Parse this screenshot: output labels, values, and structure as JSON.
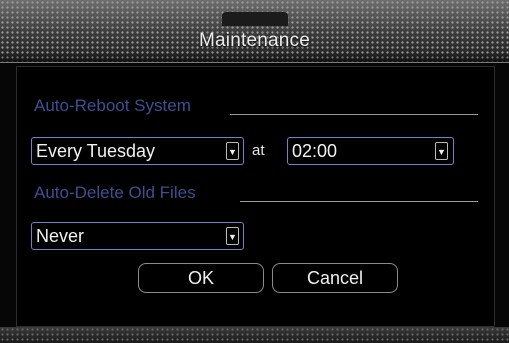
{
  "dialog": {
    "title": "Maintenance"
  },
  "auto_reboot": {
    "section_label": "Auto-Reboot System",
    "schedule_value": "Every Tuesday",
    "at_label": "at",
    "time_value": "02:00"
  },
  "auto_delete": {
    "section_label": "Auto-Delete Old Files",
    "value": "Never"
  },
  "buttons": {
    "ok_label": "OK",
    "cancel_label": "Cancel"
  },
  "colors": {
    "section_label": "#3d4f90",
    "field_border": "#6f84c8"
  }
}
